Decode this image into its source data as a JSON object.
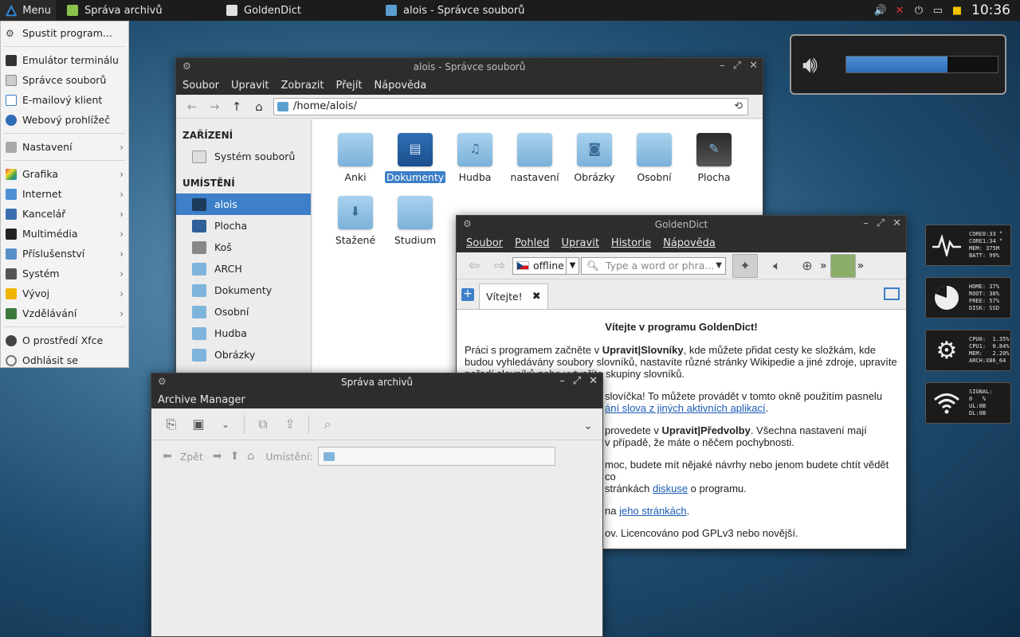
{
  "panel": {
    "menu_label": "Menu",
    "tasks": [
      {
        "label": "Správa archivů"
      },
      {
        "label": "GoldenDict"
      },
      {
        "label": "alois - Správce souborů"
      }
    ],
    "clock": "10:36"
  },
  "app_menu": {
    "items": [
      {
        "label": "Spustit program...",
        "icon": "run-icon"
      },
      {
        "label": "Emulátor terminálu",
        "icon": "terminal-icon"
      },
      {
        "label": "Správce souborů",
        "icon": "file-manager-icon"
      },
      {
        "label": "E-mailový klient",
        "icon": "mail-icon"
      },
      {
        "label": "Webový prohlížeč",
        "icon": "globe-icon"
      },
      {
        "label": "Nastavení",
        "icon": "settings-icon"
      },
      {
        "label": "Grafika",
        "icon": "graphics-icon"
      },
      {
        "label": "Internet",
        "icon": "internet-icon"
      },
      {
        "label": "Kancelář",
        "icon": "office-icon"
      },
      {
        "label": "Multimédia",
        "icon": "multimedia-icon"
      },
      {
        "label": "Příslušenství",
        "icon": "accessories-icon"
      },
      {
        "label": "Systém",
        "icon": "system-icon"
      },
      {
        "label": "Vývoj",
        "icon": "development-icon"
      },
      {
        "label": "Vzdělávání",
        "icon": "education-icon"
      },
      {
        "label": "O prostředí Xfce",
        "icon": "info-icon"
      },
      {
        "label": "Odhlásit se",
        "icon": "logout-icon"
      }
    ]
  },
  "file_manager": {
    "title": "alois - Správce souborů",
    "menus": [
      "Soubor",
      "Upravit",
      "Zobrazit",
      "Přejít",
      "Nápověda"
    ],
    "path": "/home/alois/",
    "devices_header": "ZAŘÍZENÍ",
    "devices": [
      "Systém souborů"
    ],
    "places_header": "UMÍSTĚNÍ",
    "places": [
      "alois",
      "Plocha",
      "Koš",
      "ARCH",
      "Dokumenty",
      "Osobní",
      "Hudba",
      "Obrázky"
    ],
    "folders": [
      "Anki",
      "Dokumenty",
      "Hudba",
      "nastavení",
      "Obrázky",
      "Osobní",
      "Plocha",
      "Stažené",
      "Studium"
    ]
  },
  "goldendict": {
    "title": "GoldenDict",
    "menus": [
      "Soubor",
      "Pohled",
      "Upravit",
      "Historie",
      "Nápověda"
    ],
    "group": "offline",
    "search_placeholder": "Type a word or phra...",
    "tab_label": "Vítejte!",
    "more": "»",
    "article": {
      "heading": "Vítejte v programu GoldenDict!",
      "p1_a": "Práci s programem začněte v ",
      "p1_b": "Upravit|Slovníky",
      "p1_c": ", kde můžete přidat cesty ke složkám, kde budou vyhledávány soubory slovníků, nastavíte různé stránky Wikipedie a jiné zdroje, upravíte pořadí slovníků nebo vytvoříte skupiny slovníků.",
      "p2_a": "slovíčka! To můžete provádět v tomto okně použitím pasnelu ",
      "p2_link": "ání slova z jiných aktivních aplikací",
      "p2_c": ".",
      "p3_a": "provedete v ",
      "p3_b": "Upravit|Předvolby",
      "p3_c": ". Všechna nastavení mají",
      "p3_d": " v případě, že máte o něčem pochybnosti.",
      "p4_a": "moc, budete mít nějaké návrhy nebo jenom budete chtít vědět co",
      "p4_b": " stránkách ",
      "p4_link": "diskuse",
      "p4_c": " o programu.",
      "p5_a": " na ",
      "p5_link": "jeho stránkách",
      "p5_c": ".",
      "p6": "ov. Licencováno pod GPLv3 nebo novější."
    }
  },
  "archive_manager": {
    "title": "Správa archivů",
    "subtitle": "Archive Manager",
    "back_label": "Zpět",
    "location_label": "Umístění:"
  },
  "osd": {
    "volume_fraction": 0.67
  },
  "conky": [
    {
      "icon": "activity-icon",
      "text": "CORE0:33 °\nCORE1:34 °\nMEM: 375M\nBATT: 99%"
    },
    {
      "icon": "disk-pie-icon",
      "text": "HOME: 37%\nROOT: 30%\nFREE: 57%\nDISK: SSD"
    },
    {
      "icon": "gear-icon",
      "text": "CPU0:  1.35%\nCPU1:  0.84%\nMEM:   2.20%\nARCH:X86_64"
    },
    {
      "icon": "wifi-icon",
      "text": "SIGNAL:\n0   %\nUL:0B\nDL:0B"
    }
  ],
  "colors": {
    "accent": "#3d7fc8",
    "panel": "#1c1c1c"
  }
}
